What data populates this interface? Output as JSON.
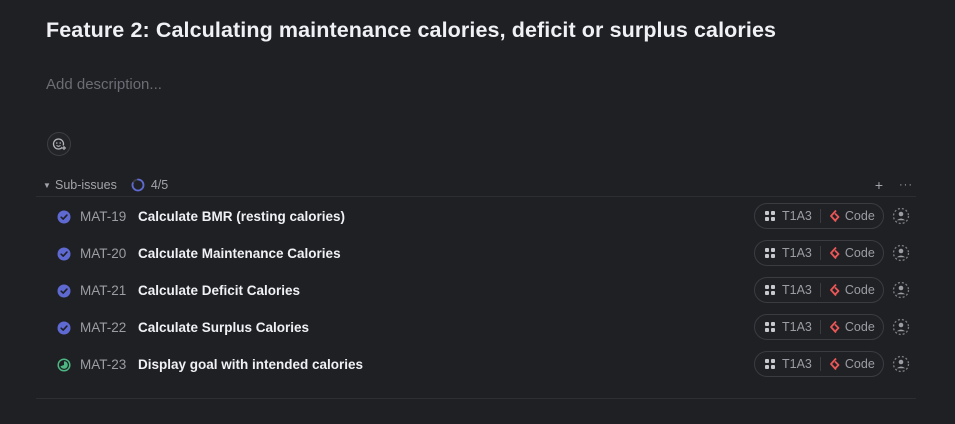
{
  "issue": {
    "title": "Feature 2: Calculating maintenance calories, deficit or surplus calories",
    "description_placeholder": "Add description..."
  },
  "icons": {
    "reaction": "add-reaction-icon",
    "caret": "caret-down-icon",
    "progress": "progress-ring-icon",
    "add": "plus-icon",
    "more": "more-horizontal-icon",
    "done": "check-circle-icon",
    "in_review": "in-progress-circle-icon",
    "project": "grid-icon",
    "label": "code-diamond-icon",
    "assignee": "unassigned-user-icon"
  },
  "colors": {
    "background": "#1f2023",
    "done": "#5e6ad2",
    "in_review": "#4cb782",
    "code_label": "#eb5757",
    "progress": "#5e6ad2"
  },
  "subissues": {
    "label": "Sub-issues",
    "count": "4/5",
    "progress": 0.8,
    "add": "+",
    "more": "···",
    "items": [
      {
        "id": "MAT-19",
        "title": "Calculate BMR (resting calories)",
        "status": "done",
        "project": "T1A3",
        "label": "Code"
      },
      {
        "id": "MAT-20",
        "title": "Calculate Maintenance Calories",
        "status": "done",
        "project": "T1A3",
        "label": "Code"
      },
      {
        "id": "MAT-21",
        "title": "Calculate Deficit Calories",
        "status": "done",
        "project": "T1A3",
        "label": "Code"
      },
      {
        "id": "MAT-22",
        "title": "Calculate Surplus Calories",
        "status": "done",
        "project": "T1A3",
        "label": "Code"
      },
      {
        "id": "MAT-23",
        "title": "Display goal with intended calories",
        "status": "in_review",
        "project": "T1A3",
        "label": "Code"
      }
    ]
  }
}
